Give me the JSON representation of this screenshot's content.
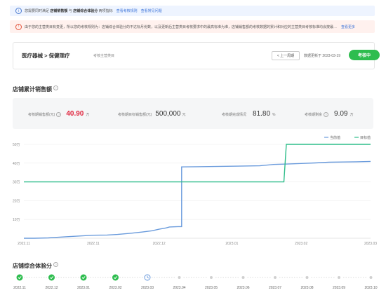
{
  "notices": {
    "info_text_prefix": "您需要同时满足",
    "info_bold1": "店铺销售额",
    "info_mid": "与",
    "info_bold2": "店铺综合体验分",
    "info_suffix": "两项指标",
    "info_link1": "查看考核规则",
    "info_link2": "查看常见问题",
    "warn_text": "由于您的主营类目有变更，所以您的考核规则为：店铺综合体验分的不达标月份数，以及更新后主营类目考核要求中的最高标准为准，店铺销售额的考核数据的累计和对应的主营类目考核标准均会按最新主营类目",
    "warn_link": "查看更多"
  },
  "category_bar": {
    "path": "医疗器械 > 保健理疗",
    "sub_label": "考核主营类目",
    "prev_button": "< 上一周期",
    "update_label": "数据更新于",
    "update_date": "2023-03-19",
    "status": "考核中"
  },
  "sales": {
    "title": "店铺累计销售额",
    "kpis": [
      {
        "label": "考核期销售额(元)",
        "value": "40.90",
        "unit": "万"
      },
      {
        "label": "考核期目标销售额(元)",
        "value": "500,000",
        "unit": "元"
      },
      {
        "label": "考核期完成情况",
        "value": "81.80",
        "unit": "%"
      },
      {
        "label": "考核期剩余",
        "value": "9.09",
        "unit": "万"
      }
    ]
  },
  "chart_data": {
    "type": "line",
    "legend_position": "top-right",
    "grid": true,
    "y_ticks": [
      "10万",
      "20万",
      "30万",
      "40万",
      "50万"
    ],
    "x_ticks": [
      "2022.11",
      "2022.11",
      "2022.12",
      "2023.01",
      "2023.02",
      "2023.03"
    ],
    "ylim": [
      0,
      500000
    ],
    "series": [
      {
        "name": "当前值",
        "color": "#6a9bdc",
        "points": [
          [
            0,
            0
          ],
          [
            0.03,
            0
          ],
          [
            0.07,
            2000
          ],
          [
            0.12,
            8000
          ],
          [
            0.16,
            12000
          ],
          [
            0.2,
            16000
          ],
          [
            0.24,
            17000
          ],
          [
            0.27,
            20000
          ],
          [
            0.31,
            27000
          ],
          [
            0.34,
            33000
          ],
          [
            0.37,
            40000
          ],
          [
            0.39,
            48000
          ],
          [
            0.41,
            55000
          ],
          [
            0.42,
            60000
          ],
          [
            0.445,
            62000
          ],
          [
            0.455,
            62000
          ],
          [
            0.455,
            380000
          ],
          [
            0.5,
            381000
          ],
          [
            0.55,
            382000
          ],
          [
            0.62,
            384000
          ],
          [
            0.68,
            386000
          ],
          [
            0.72,
            393000
          ],
          [
            0.76,
            395000
          ],
          [
            0.8,
            398000
          ],
          [
            0.84,
            401000
          ],
          [
            0.88,
            405000
          ],
          [
            0.92,
            406000
          ],
          [
            0.96,
            407000
          ],
          [
            1.0,
            409000
          ]
        ]
      },
      {
        "name": "目标值",
        "color": "#2ebd8a",
        "points": [
          [
            0,
            300000
          ],
          [
            0.458,
            300000
          ],
          [
            0.458,
            300000
          ],
          [
            0.75,
            300000
          ],
          [
            0.757,
            500000
          ],
          [
            1.0,
            500000
          ]
        ]
      }
    ]
  },
  "experience": {
    "title": "店铺综合体验分",
    "months": [
      "2022.11",
      "2022.12",
      "2023.01",
      "2023.02",
      "2023.03",
      "2023.04",
      "2023.05",
      "2023.06",
      "2023.07",
      "2023.08",
      "2023.09",
      "2023.10"
    ],
    "states": [
      "done",
      "done",
      "done",
      "done",
      "current",
      "pending",
      "pending",
      "pending",
      "pending",
      "pending",
      "pending",
      "pending"
    ]
  },
  "colors": {
    "accent_red": "#e0273f",
    "status_green": "#2ebd4f",
    "link_blue": "#3a72d8"
  }
}
